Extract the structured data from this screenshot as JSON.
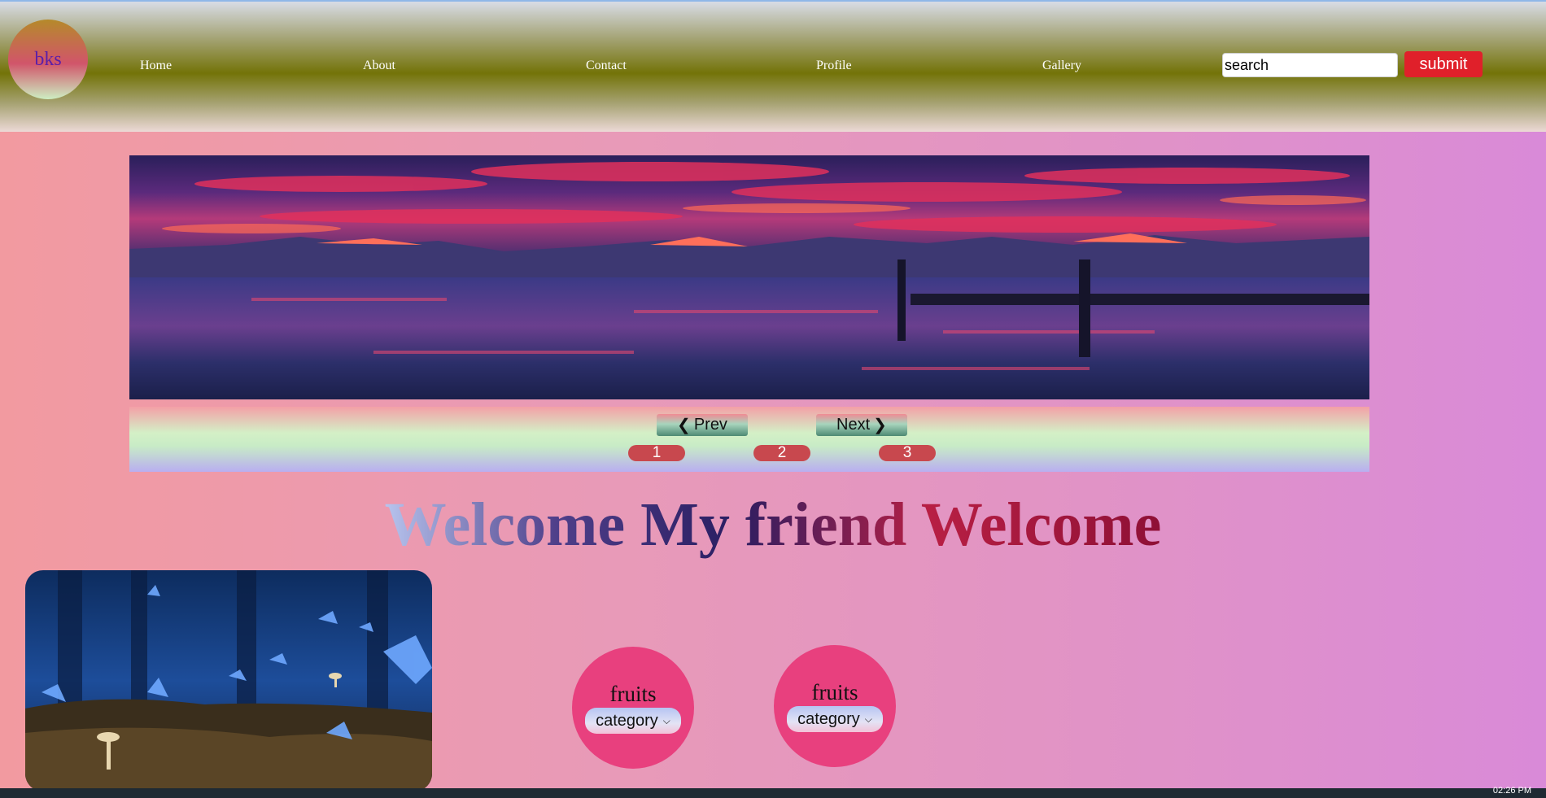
{
  "header": {
    "logo_text": "bks",
    "nav": [
      "Home",
      "About",
      "Contact",
      "Profile",
      "Gallery"
    ],
    "search_placeholder": "search",
    "search_value": "search",
    "submit_label": "submit"
  },
  "slider": {
    "prev_label": "Prev",
    "next_label": "Next",
    "pages": [
      "1",
      "2",
      "3"
    ]
  },
  "welcome_text": "Welcome My friend Welcome",
  "cards": [
    {
      "title": "fruits",
      "select_value": "category"
    },
    {
      "title": "fruits",
      "select_value": "category"
    }
  ],
  "taskbar": {
    "clock": "02:26 PM"
  },
  "colors": {
    "submit": "#e0202a",
    "card": "#e8407e",
    "dot": "#c8484e"
  }
}
